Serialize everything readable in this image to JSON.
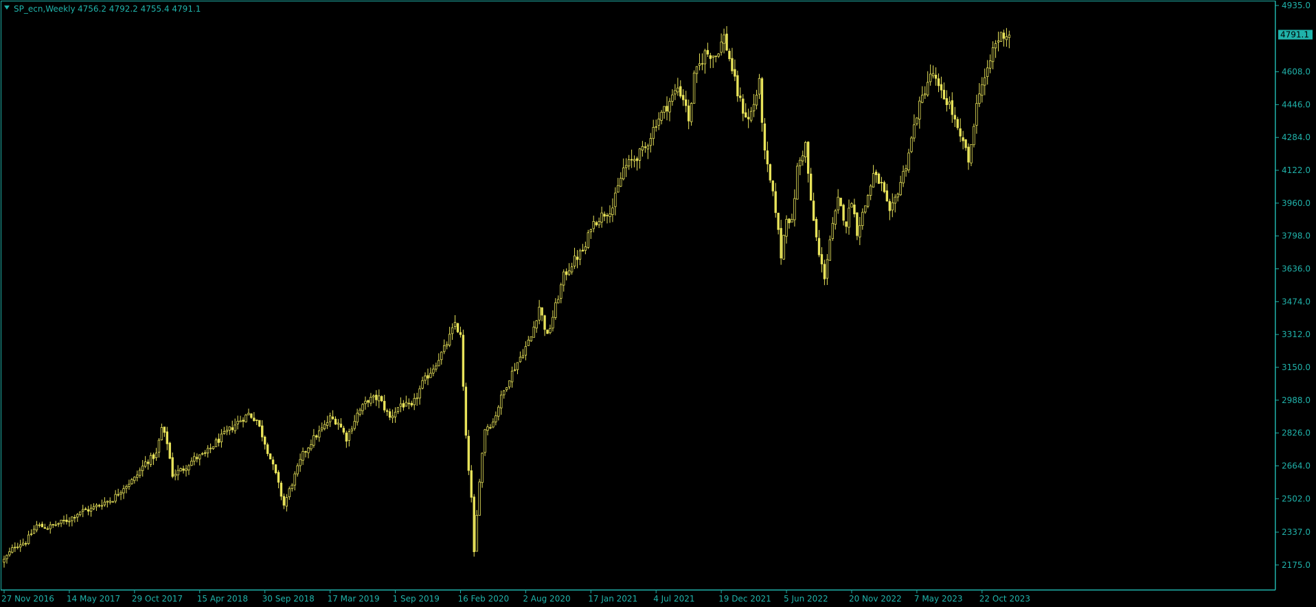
{
  "chart_data": {
    "type": "candlestick",
    "symbol_label": "SP_ecn,Weekly",
    "ohlc_label": "4756.2 4792.2 4755.4 4791.1",
    "current_price": "4791.1",
    "ylim": [
      2110,
      4935
    ],
    "y_ticks": [
      "4935.0",
      "4608.0",
      "4446.0",
      "4284.0",
      "4122.0",
      "3960.0",
      "3798.0",
      "3636.0",
      "3474.0",
      "3312.0",
      "3150.0",
      "2988.0",
      "2826.0",
      "2664.0",
      "2502.0",
      "2337.0",
      "2175.0"
    ],
    "x_ticks": [
      {
        "label": "27 Nov 2016",
        "week": 0
      },
      {
        "label": "14 May 2017",
        "week": 24
      },
      {
        "label": "29 Oct 2017",
        "week": 48
      },
      {
        "label": "15 Apr 2018",
        "week": 72
      },
      {
        "label": "30 Sep 2018",
        "week": 96
      },
      {
        "label": "17 Mar 2019",
        "week": 120
      },
      {
        "label": "1 Sep 2019",
        "week": 144
      },
      {
        "label": "16 Feb 2020",
        "week": 168
      },
      {
        "label": "2 Aug 2020",
        "week": 192
      },
      {
        "label": "17 Jan 2021",
        "week": 216
      },
      {
        "label": "4 Jul 2021",
        "week": 240
      },
      {
        "label": "19 Dec 2021",
        "week": 264
      },
      {
        "label": "5 Jun 2022",
        "week": 288
      },
      {
        "label": "20 Nov 2022",
        "week": 312
      },
      {
        "label": "7 May 2023",
        "week": 336
      },
      {
        "label": "22 Oct 2023",
        "week": 360
      }
    ],
    "total_weeks": 371,
    "anchors": [
      [
        0,
        2200
      ],
      [
        4,
        2270
      ],
      [
        8,
        2290
      ],
      [
        12,
        2370
      ],
      [
        16,
        2360
      ],
      [
        20,
        2380
      ],
      [
        24,
        2400
      ],
      [
        28,
        2440
      ],
      [
        32,
        2450
      ],
      [
        36,
        2480
      ],
      [
        40,
        2500
      ],
      [
        44,
        2560
      ],
      [
        48,
        2600
      ],
      [
        52,
        2680
      ],
      [
        56,
        2720
      ],
      [
        58,
        2850
      ],
      [
        60,
        2780
      ],
      [
        62,
        2620
      ],
      [
        66,
        2650
      ],
      [
        70,
        2700
      ],
      [
        74,
        2720
      ],
      [
        78,
        2780
      ],
      [
        82,
        2830
      ],
      [
        86,
        2880
      ],
      [
        88,
        2900
      ],
      [
        90,
        2920
      ],
      [
        93,
        2890
      ],
      [
        96,
        2780
      ],
      [
        100,
        2620
      ],
      [
        103,
        2470
      ],
      [
        106,
        2580
      ],
      [
        110,
        2720
      ],
      [
        114,
        2800
      ],
      [
        118,
        2860
      ],
      [
        120,
        2900
      ],
      [
        123,
        2880
      ],
      [
        126,
        2800
      ],
      [
        130,
        2920
      ],
      [
        134,
        2990
      ],
      [
        138,
        3000
      ],
      [
        142,
        2900
      ],
      [
        146,
        2970
      ],
      [
        150,
        2950
      ],
      [
        154,
        3070
      ],
      [
        158,
        3150
      ],
      [
        162,
        3240
      ],
      [
        165,
        3330
      ],
      [
        166,
        3370
      ],
      [
        168,
        3300
      ],
      [
        170,
        2800
      ],
      [
        172,
        2500
      ],
      [
        173,
        2230
      ],
      [
        175,
        2600
      ],
      [
        177,
        2850
      ],
      [
        180,
        2880
      ],
      [
        183,
        3000
      ],
      [
        186,
        3100
      ],
      [
        190,
        3200
      ],
      [
        194,
        3300
      ],
      [
        197,
        3450
      ],
      [
        198,
        3400
      ],
      [
        200,
        3300
      ],
      [
        203,
        3450
      ],
      [
        206,
        3600
      ],
      [
        210,
        3680
      ],
      [
        214,
        3740
      ],
      [
        216,
        3850
      ],
      [
        220,
        3900
      ],
      [
        224,
        3940
      ],
      [
        228,
        4130
      ],
      [
        232,
        4180
      ],
      [
        236,
        4230
      ],
      [
        240,
        4360
      ],
      [
        244,
        4440
      ],
      [
        248,
        4530
      ],
      [
        251,
        4450
      ],
      [
        252,
        4350
      ],
      [
        254,
        4580
      ],
      [
        258,
        4700
      ],
      [
        262,
        4690
      ],
      [
        265,
        4780
      ],
      [
        268,
        4620
      ],
      [
        270,
        4500
      ],
      [
        272,
        4420
      ],
      [
        274,
        4370
      ],
      [
        276,
        4450
      ],
      [
        278,
        4550
      ],
      [
        280,
        4200
      ],
      [
        284,
        3930
      ],
      [
        286,
        3700
      ],
      [
        288,
        3900
      ],
      [
        290,
        3860
      ],
      [
        292,
        4130
      ],
      [
        295,
        4250
      ],
      [
        297,
        3960
      ],
      [
        300,
        3700
      ],
      [
        302,
        3600
      ],
      [
        304,
        3780
      ],
      [
        307,
        3970
      ],
      [
        310,
        3860
      ],
      [
        312,
        3980
      ],
      [
        314,
        3820
      ],
      [
        317,
        3950
      ],
      [
        320,
        4100
      ],
      [
        323,
        4050
      ],
      [
        326,
        3900
      ],
      [
        328,
        3980
      ],
      [
        332,
        4150
      ],
      [
        336,
        4400
      ],
      [
        338,
        4480
      ],
      [
        340,
        4560
      ],
      [
        342,
        4600
      ],
      [
        344,
        4520
      ],
      [
        346,
        4480
      ],
      [
        348,
        4450
      ],
      [
        350,
        4360
      ],
      [
        352,
        4270
      ],
      [
        354,
        4240
      ],
      [
        355,
        4140
      ],
      [
        357,
        4360
      ],
      [
        359,
        4520
      ],
      [
        362,
        4600
      ],
      [
        364,
        4720
      ],
      [
        367,
        4791
      ],
      [
        370,
        4791
      ]
    ]
  }
}
